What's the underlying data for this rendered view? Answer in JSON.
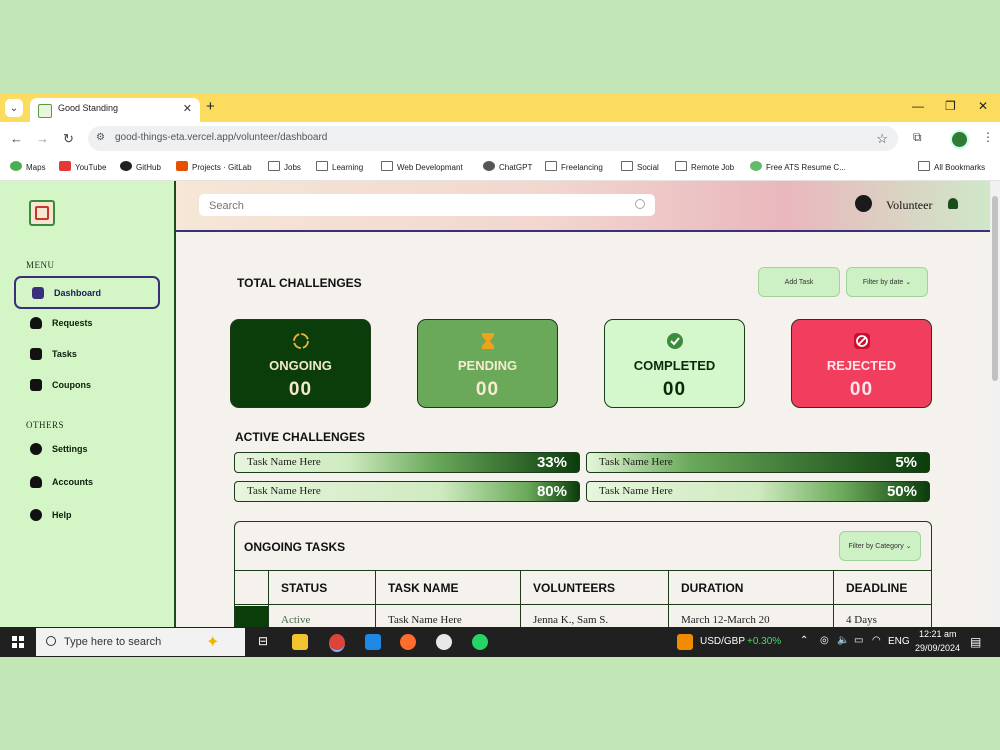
{
  "browser": {
    "tab_title": "Good Standing",
    "url": "good-things-eta.vercel.app/volunteer/dashboard",
    "bookmarks": [
      "Maps",
      "YouTube",
      "GitHub",
      "Projects · GitLab",
      "Jobs",
      "Learning",
      "Web Developmant",
      "ChatGPT",
      "Freelancing",
      "Social",
      "Remote Job",
      "Free ATS Resume C...",
      "All Bookmarks"
    ]
  },
  "sidebar": {
    "menu_label": "MENU",
    "others_label": "OTHERS",
    "items": [
      {
        "label": "Dashboard",
        "icon": "chart-icon"
      },
      {
        "label": "Requests",
        "icon": "person-plus-icon"
      },
      {
        "label": "Tasks",
        "icon": "chat-icon"
      },
      {
        "label": "Coupons",
        "icon": "coupon-icon"
      },
      {
        "label": "Settings",
        "icon": "gear-icon"
      },
      {
        "label": "Accounts",
        "icon": "person-icon"
      },
      {
        "label": "Help",
        "icon": "info-icon"
      }
    ]
  },
  "header": {
    "search_placeholder": "Search",
    "user_name": "Volunteer"
  },
  "main": {
    "total_title": "TOTAL CHALLENGES",
    "add_task_label": "Add Task",
    "filter_date_label": "Filter by date",
    "cards": [
      {
        "title": "ONGOING",
        "count": "00",
        "bg": "#0b3d0b",
        "fg": "#f2e9c9",
        "icon": "sync-icon"
      },
      {
        "title": "PENDING",
        "count": "00",
        "bg": "#6aa95a",
        "fg": "#f7ecd0",
        "icon": "hourglass-icon"
      },
      {
        "title": "COMPLETED",
        "count": "00",
        "bg": "#d5f7cc",
        "fg": "#0b2a0b",
        "icon": "check-circle-icon"
      },
      {
        "title": "REJECTED",
        "count": "00",
        "bg": "#f23e5e",
        "fg": "#fde8ea",
        "icon": "reject-icon"
      }
    ],
    "active_title": "ACTIVE CHALLENGES",
    "active_challenges": [
      {
        "name": "Task Name Here",
        "percent": "33%",
        "value": 33
      },
      {
        "name": "Task Name Here",
        "percent": "5%",
        "value": 5
      },
      {
        "name": "Task Name Here",
        "percent": "80%",
        "value": 80
      },
      {
        "name": "Task Name Here",
        "percent": "50%",
        "value": 50
      }
    ],
    "ongoing_title": "ONGOING TASKS",
    "filter_category_label": "Filter by Category",
    "table": {
      "headers": [
        "STATUS",
        "TASK NAME",
        "VOLUNTEERS",
        "DURATION",
        "DEADLINE"
      ],
      "rows": [
        [
          "Active",
          "Task Name Here",
          "Jenna K., Sam S.",
          "March 12-March 20",
          "4 Days"
        ]
      ]
    }
  },
  "taskbar": {
    "search_placeholder": "Type here to search",
    "ticker_label": "USD/GBP",
    "ticker_change": "+0.30%",
    "language": "ENG",
    "time": "12:21 am",
    "date": "29/09/2024"
  }
}
